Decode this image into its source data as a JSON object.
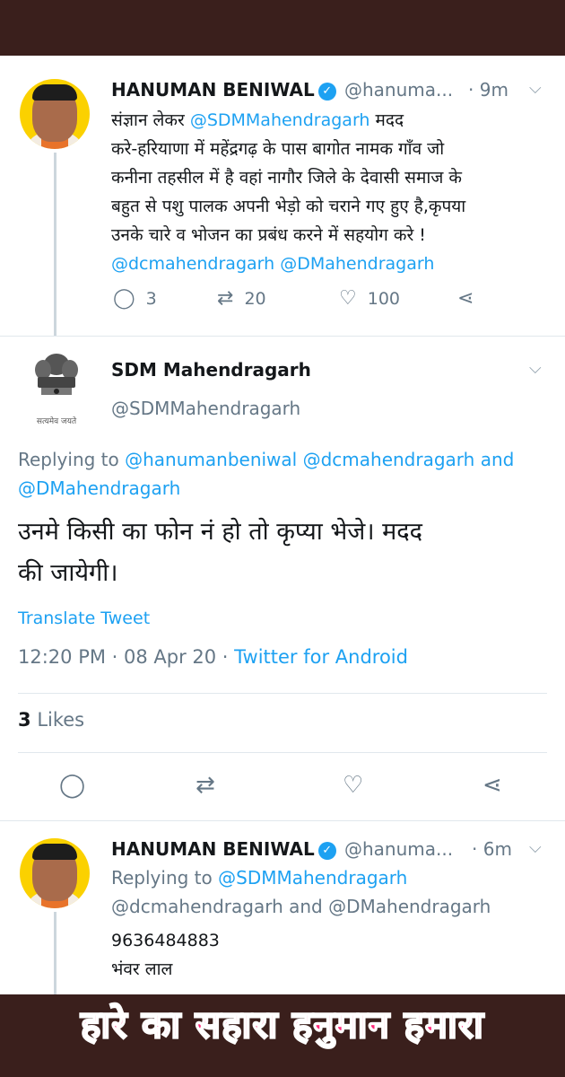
{
  "tweet1": {
    "author_name": "HANUMAN BENIWAL",
    "verified_mark": "✓",
    "handle": "@hanuma...",
    "time": "· 9m",
    "lines": [
      "संज्ञान लेकर",
      "@SDMMahendragarh",
      "मदद",
      "करे-हरियाणा में महेंद्रगढ़ के पास बागोत नामक गाँव जो",
      "कनीना तहसील में है वहां नागौर जिले के देवासी समाज के",
      "बहुत से पशु पालक अपनी भेड़ो को चराने गए हुए है,कृपया",
      "उनके चारे व भोजन का प्रबंध करने में सहयोग करे !",
      "@dcmahendragarh @DMahendragarh"
    ],
    "reply_count": "3",
    "retweet_count": "20",
    "like_count": "100"
  },
  "tweet2": {
    "author_name": "SDM Mahendragarh",
    "handle": "@SDMMahendragarh",
    "emblem_caption": "सत्यमेव जयते",
    "replying_prefix": "Replying to",
    "replying_targets": "@hanumanbeniwal @dcmahendragarh and @DMahendragarh",
    "text_line1": "उनमे किसी का फोन नं हो तो कृप्या भेजे। मदद",
    "text_line2": "की जायेगी।",
    "translate_label": "Translate Tweet",
    "timestamp": "12:20 PM · 08 Apr 20 ·",
    "client": "Twitter for Android",
    "likes_count": "3",
    "likes_label": "Likes"
  },
  "tweet3": {
    "author_name": "HANUMAN BENIWAL",
    "verified_mark": "✓",
    "handle": "@hanuma...",
    "time": "· 6m",
    "replying_prefix": "Replying to",
    "replying_line1": "@SDMMahendragarh",
    "replying_line2": "@dcmahendragarh and @DMahendragarh",
    "phone": "9636484883",
    "name": "भंवर लाल"
  },
  "banner_text": "हारे का सहारा हनुमान हमारा",
  "icons": {
    "chevron": "chevron-down-icon",
    "reply": "reply-icon",
    "retweet": "retweet-icon",
    "like": "heart-icon",
    "share": "share-icon"
  },
  "colors": {
    "link": "#1da1f2",
    "text": "#14171a",
    "muted": "#657786",
    "band": "#3a1f1c",
    "banner_text": "#ff2a7a"
  }
}
